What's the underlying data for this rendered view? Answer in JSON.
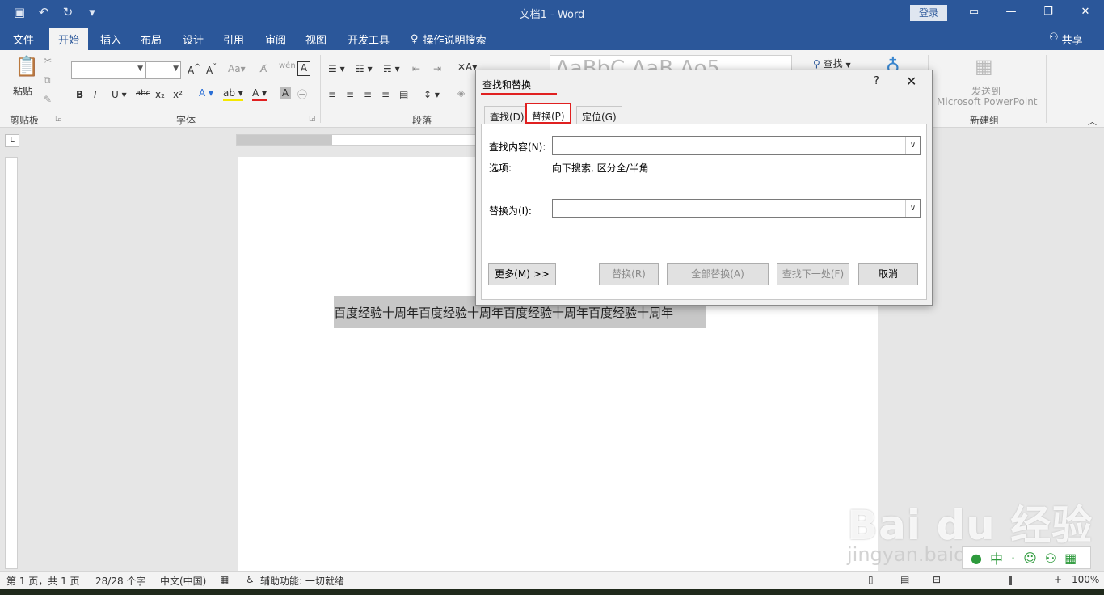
{
  "window": {
    "title": "文档1  -  Word",
    "login_label": "登录"
  },
  "tabs": [
    {
      "label": "文件"
    },
    {
      "label": "开始"
    },
    {
      "label": "插入"
    },
    {
      "label": "布局"
    },
    {
      "label": "设计"
    },
    {
      "label": "引用"
    },
    {
      "label": "审阅"
    },
    {
      "label": "视图"
    },
    {
      "label": "开发工具"
    }
  ],
  "tell_me": "操作说明搜索",
  "share": "共享",
  "ribbon": {
    "paste_label": "粘贴",
    "clipboard_label": "剪贴板",
    "font_label": "字体",
    "paragraph_label": "段落",
    "find_label": "查找",
    "send_to_label": "发送到",
    "send_to_sub": "Microsoft PowerPoint",
    "new_group_label": "新建组",
    "style_preview": "AaBbC AaB  Ao5  AaBbC"
  },
  "document": {
    "selected_text": "百度经验十周年百度经验十周年百度经验十周年百度经验十周年"
  },
  "dialog": {
    "title": "查找和替换",
    "help": "?",
    "close": "✕",
    "tabs": [
      {
        "label": "查找(D)"
      },
      {
        "label": "替换(P)"
      },
      {
        "label": "定位(G)"
      }
    ],
    "find_label": "查找内容(N):",
    "find_value": "",
    "options_label": "选项:",
    "options_value": "向下搜索, 区分全/半角",
    "replace_label": "替换为(I):",
    "replace_value": "",
    "buttons": {
      "more": "更多(M) >>",
      "replace": "替换(R)",
      "replace_all": "全部替换(A)",
      "find_next": "查找下一处(F)",
      "cancel": "取消"
    }
  },
  "status": {
    "page": "第 1 页，共 1 页",
    "words": "28/28 个字",
    "language": "中文(中国)",
    "accessibility": "辅助功能: 一切就绪",
    "zoom": "100%"
  },
  "watermark": {
    "brand": "Bai du 经验",
    "url": "jingyan.baidu.com"
  }
}
